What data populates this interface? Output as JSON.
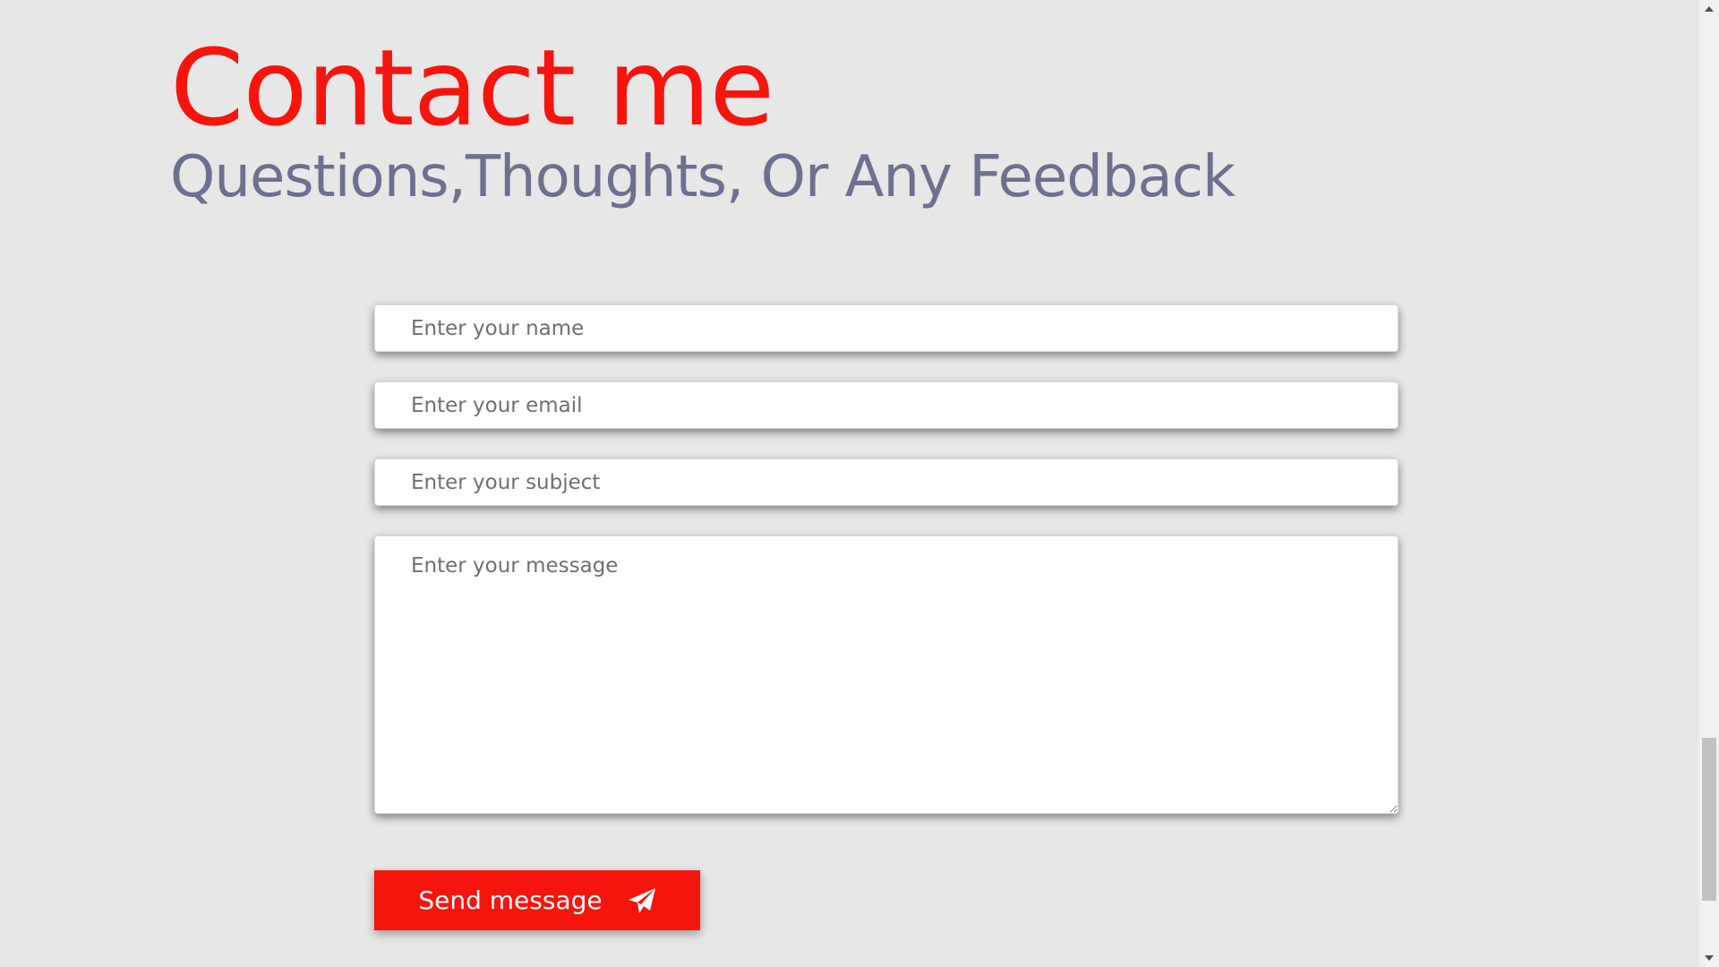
{
  "header": {
    "title": "Contact me",
    "subtitle": "Questions,Thoughts, Or Any Feedback"
  },
  "form": {
    "name_placeholder": "Enter your name",
    "email_placeholder": "Enter your email",
    "subject_placeholder": "Enter your subject",
    "message_placeholder": "Enter your message",
    "submit_label": "Send message",
    "submit_icon": "paper-plane-icon"
  },
  "colors": {
    "accent": "#f5150d",
    "subtitle": "#6c7190",
    "background": "#e7e7e7"
  }
}
